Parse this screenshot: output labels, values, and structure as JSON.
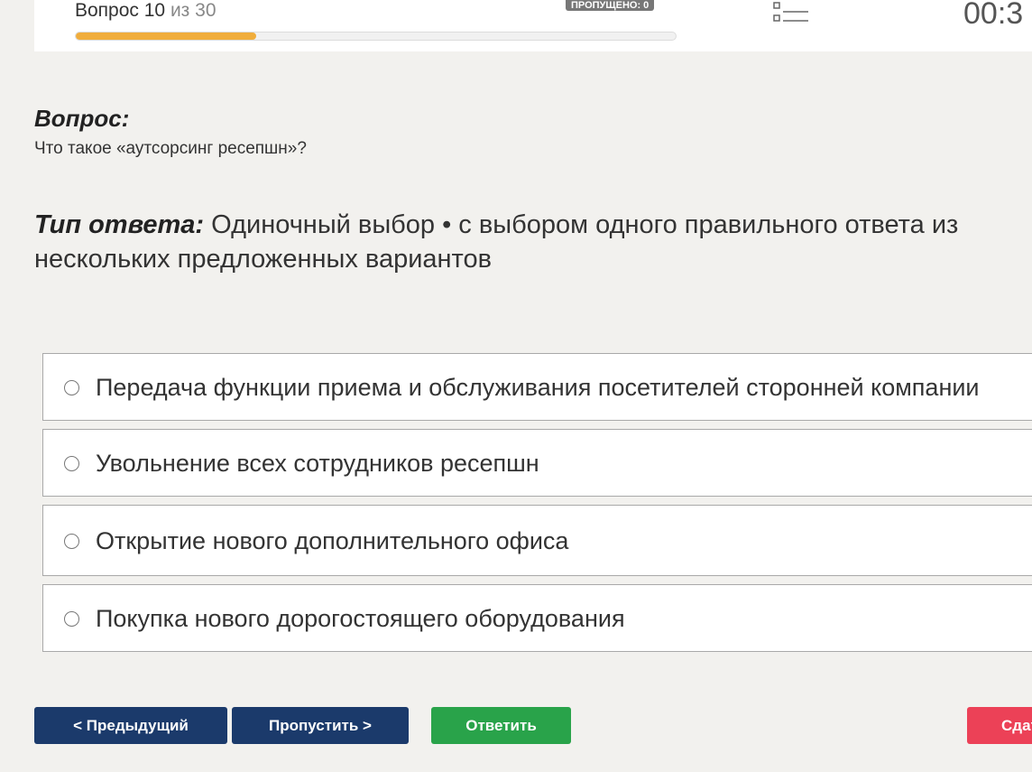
{
  "header": {
    "question_label": "Вопрос 10",
    "of_label": "из",
    "total": "30",
    "progress_fraction": 0.3,
    "skipped_badge": "ПРОПУЩЕНО: 0",
    "timer": "00:3"
  },
  "question": {
    "heading": "Вопрос:",
    "text": "Что такое «аутсорсинг ресепшн»?"
  },
  "answer_type": {
    "label": "Тип ответа:",
    "text": "Одиночный выбор • с выбором одного правильного ответа из нескольких предложенных вариантов"
  },
  "options": [
    "Передача функции приема и обслуживания посетителей сторонней компании",
    "Увольнение всех сотрудников ресепшн",
    "Открытие нового дополнительного офиса",
    "Покупка нового дорогостоящего оборудования"
  ],
  "buttons": {
    "prev": "< Предыдущий",
    "skip": "Пропустить >",
    "answer": "Ответить",
    "submit": "Сдат"
  },
  "colors": {
    "progress": "#f0ad3c",
    "nav_button": "#1b3a6b",
    "answer_button": "#29a34a",
    "submit_button": "#ec4157"
  }
}
